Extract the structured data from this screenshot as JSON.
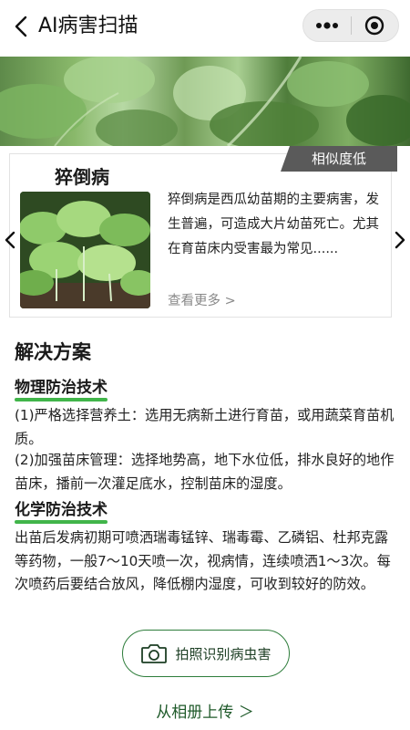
{
  "header": {
    "title": "AI病害扫描",
    "back_icon": "chevron-left-icon",
    "more_icon": "more-dots-icon",
    "close_icon": "target-circle-icon"
  },
  "banner": {
    "image": "green-leaves-photo"
  },
  "card": {
    "badge": "相似度低",
    "name": "猝倒病",
    "description": "猝倒病是西瓜幼苗期的主要病害，发生普遍，可造成大片幼苗死亡。尤其在育苗床内受害最为常见......",
    "see_more": "查看更多 >",
    "image": "seedling-photo"
  },
  "solution": {
    "title": "解决方案",
    "physical_title": "物理防治技术",
    "physical_p1": "(1)严格选择营养土：选用无病新土进行育苗，或用蔬菜育苗机质。",
    "physical_p2": "(2)加强苗床管理：选择地势高，地下水位低，排水良好的地作苗床，播前一次灌足底水，控制苗床的湿度。",
    "chemical_title": "化学防治技术",
    "chemical_p1": "出苗后发病初期可喷洒瑞毒锰锌、瑞毒霉、乙磷铝、杜邦克露等药物，一般7～10天喷一次，视病情，连续喷洒1～3次。每次喷药后要结合放风，降低棚内湿度，可收到较好的防效。"
  },
  "actions": {
    "photo_button": "拍照识别病虫害",
    "album_link": "从相册上传 ＞"
  },
  "colors": {
    "accent_green": "#41b54a",
    "badge_gray": "#5a5a5a"
  }
}
